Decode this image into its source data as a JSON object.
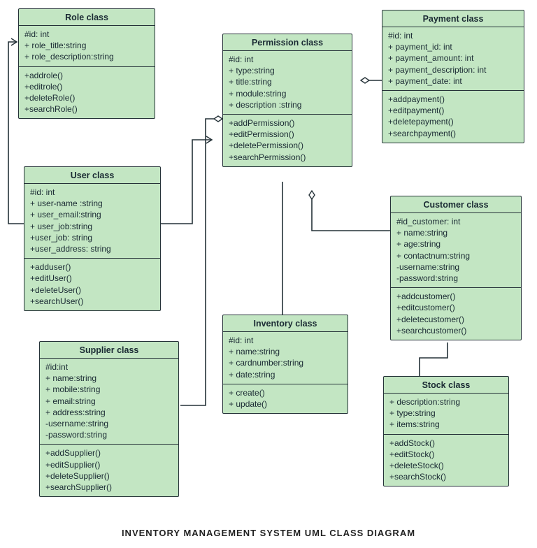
{
  "caption": "INVENTORY  MANAGEMENT  SYSTEM UML CLASS DIAGRAM",
  "classes": {
    "role": {
      "title": "Role class",
      "attrs": [
        "#id: int",
        "+ role_title:string",
        "+ role_description:string"
      ],
      "ops": [
        "+addrole()",
        "+editrole()",
        "+deleteRole()",
        "+searchRole()"
      ]
    },
    "user": {
      "title": "User class",
      "attrs": [
        "#id: int",
        "+ user-name :string",
        "+ user_email:string",
        "+ user_job:string",
        "+user_job: string",
        "+user_address: string"
      ],
      "ops": [
        "+adduser()",
        "+editUser()",
        "+deleteUser()",
        "+searchUser()"
      ]
    },
    "supplier": {
      "title": "Supplier class",
      "attrs": [
        "#id:int",
        "+ name:string",
        "+ mobile:string",
        "+ email:string",
        "+ address:string",
        "-username:string",
        "-password:string"
      ],
      "ops": [
        "+addSupplier()",
        "+editSupplier()",
        "+deleteSupplier()",
        "+searchSupplier()"
      ]
    },
    "permission": {
      "title": "Permission class",
      "attrs": [
        "#id: int",
        "+ type:string",
        "+ title:string",
        "+ module:string",
        "+ description :string"
      ],
      "ops": [
        "+addPermission()",
        "+editPermission()",
        "+deletePermission()",
        "+searchPermission()"
      ]
    },
    "payment": {
      "title": "Payment class",
      "attrs": [
        "#id: int",
        "+ payment_id: int",
        "+ payment_amount: int",
        "+ payment_description: int",
        "+ payment_date: int"
      ],
      "ops": [
        "+addpayment()",
        "+editpayment()",
        "+deletepayment()",
        "+searchpayment()"
      ]
    },
    "inventory": {
      "title": "Inventory class",
      "attrs": [
        "#id: int",
        "+ name:string",
        "+ cardnumber:string",
        "+ date:string"
      ],
      "ops": [
        "+ create()",
        "+ update()"
      ]
    },
    "customer": {
      "title": "Customer class",
      "attrs": [
        "#id_customer: int",
        "+ name:string",
        "+ age:string",
        "+ contactnum:string",
        "-username:string",
        "-password:string"
      ],
      "ops": [
        "+addcustomer()",
        "+editcustomer()",
        "+deletecustomer()",
        "+searchcustomer()"
      ]
    },
    "stock": {
      "title": "Stock class",
      "attrs": [
        "+ description:string",
        "+ type:string",
        "+ items:string"
      ],
      "ops": [
        "+addStock()",
        "+editStock()",
        "+deleteStock()",
        "+searchStock()"
      ]
    }
  }
}
